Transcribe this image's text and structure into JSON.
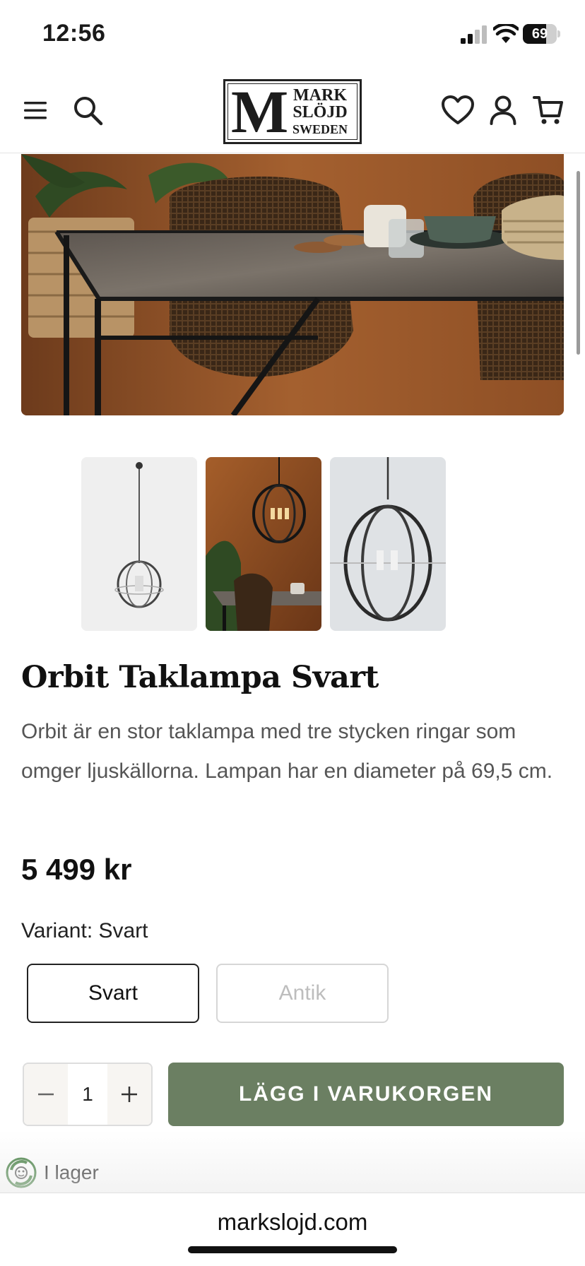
{
  "status_bar": {
    "time": "12:56",
    "battery": "69",
    "battery_level": 0.69
  },
  "header": {
    "logo_letter": "M",
    "logo_lines": [
      "MARK",
      "SLÖJD",
      "SWEDEN"
    ],
    "icons": [
      "menu-icon",
      "search-icon",
      "heart-icon",
      "account-icon",
      "cart-icon"
    ]
  },
  "gallery": {
    "thumbnails": [
      {
        "name": "thumbnail-white-background"
      },
      {
        "name": "thumbnail-room-setting"
      },
      {
        "name": "thumbnail-closeup"
      }
    ]
  },
  "product": {
    "title": "Orbit Taklampa Svart",
    "description": "Orbit är en stor taklampa med tre stycken ringar som omger ljuskällorna. Lampan har en diameter på 69,5 cm.",
    "price": "5 499 kr",
    "variant_label": "Variant: Svart",
    "variants": [
      {
        "label": "Svart",
        "selected": true,
        "available": true
      },
      {
        "label": "Antik",
        "selected": false,
        "available": false
      }
    ],
    "quantity": "1",
    "add_to_cart": "LÄGG I VARUKORGEN",
    "stock_status": "I lager"
  },
  "browser": {
    "url": "markslojd.com"
  },
  "colors": {
    "accent_green": "#6b7f62",
    "text_dark": "#111111",
    "text_muted": "#555555",
    "disabled": "#bdbdbd"
  }
}
